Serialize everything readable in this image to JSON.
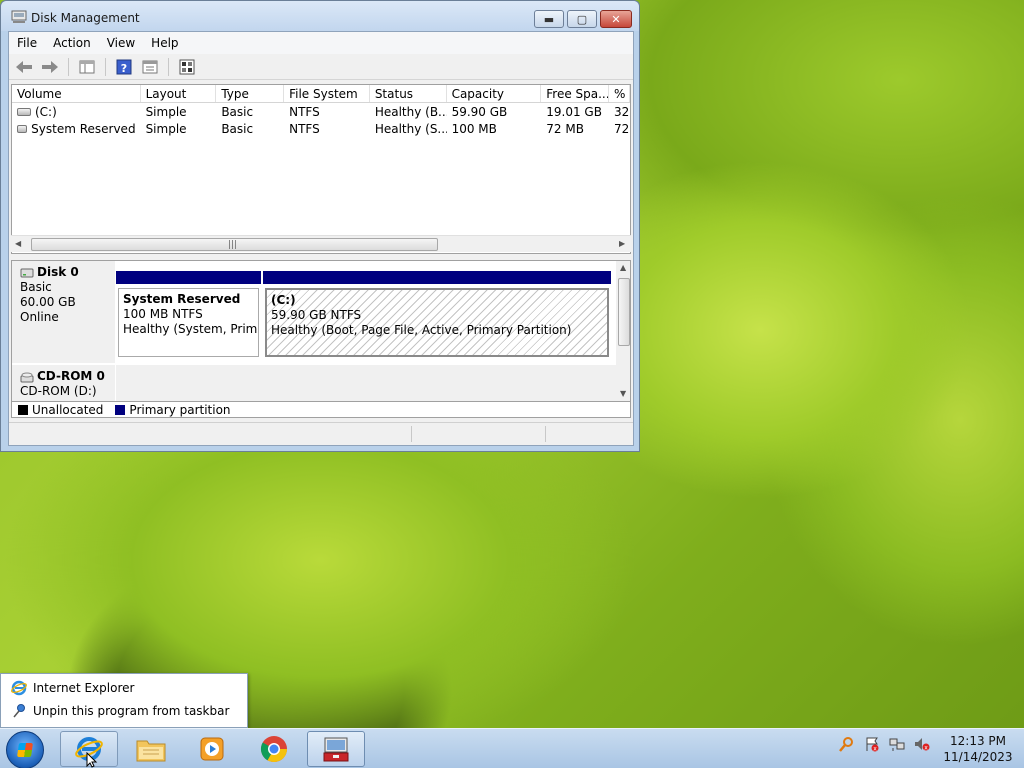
{
  "window": {
    "title": "Disk Management",
    "controls": {
      "minimize": "▬",
      "maximize": "▢",
      "close": "✕"
    }
  },
  "menu": [
    "File",
    "Action",
    "View",
    "Help"
  ],
  "listview": {
    "columns": [
      "Volume",
      "Layout",
      "Type",
      "File System",
      "Status",
      "Capacity",
      "Free Spa...",
      "% F"
    ],
    "rows": [
      {
        "volume": "(C:)",
        "layout": "Simple",
        "type": "Basic",
        "fs": "NTFS",
        "status": "Healthy (B...",
        "capacity": "59.90 GB",
        "free": "19.01 GB",
        "pct": "32"
      },
      {
        "volume": "System Reserved",
        "layout": "Simple",
        "type": "Basic",
        "fs": "NTFS",
        "status": "Healthy (S...",
        "capacity": "100 MB",
        "free": "72 MB",
        "pct": "72"
      }
    ]
  },
  "disks": {
    "disk0": {
      "name": "Disk 0",
      "type": "Basic",
      "size": "60.00 GB",
      "state": "Online",
      "partitions": {
        "system_reserved": {
          "name": "System Reserved",
          "size": "100 MB NTFS",
          "status": "Healthy (System, Primar"
        },
        "c": {
          "name": "(C:)",
          "size": "59.90 GB NTFS",
          "status": "Healthy (Boot, Page File, Active, Primary Partition)"
        }
      }
    },
    "cdrom0": {
      "name": "CD-ROM 0",
      "drive": "CD-ROM (D:)"
    }
  },
  "legend": [
    {
      "label": "Unallocated",
      "color": "#000000"
    },
    {
      "label": "Primary partition",
      "color": "#00007f"
    }
  ],
  "jumplist": {
    "items": [
      "Internet Explorer",
      "Unpin this program from taskbar"
    ]
  },
  "clock": {
    "time": "12:13 PM",
    "date": "11/14/2023"
  }
}
